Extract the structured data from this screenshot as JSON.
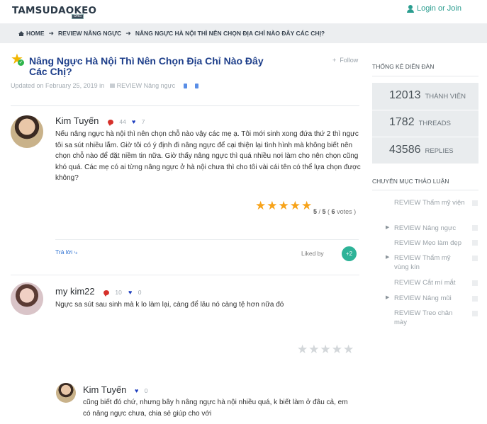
{
  "header": {
    "logo": "TAMSUDAOKEO",
    "logo_sub": "ORG",
    "login": "Login or Join"
  },
  "breadcrumbs": [
    "HOME",
    "REVIEW NÂNG NGỰC",
    "NÂNG NGỰC HÀ NỘI THÌ NÊN CHỌN ĐỊA CHỈ NÀO ĐÂY CÁC CHỊ?"
  ],
  "thread": {
    "title": "Nâng Ngực Hà Nội Thì Nên Chọn Địa Chỉ Nào Đây Các Chị?",
    "follow": "Follow",
    "meta_updated": "Updated on February 25, 2019 in",
    "meta_category": "REVIEW Nâng ngực"
  },
  "posts": [
    {
      "author": "Kim Tuyến",
      "comments": "44",
      "likes": "7",
      "text": "Nếu nâng ngực hà nội thì nên chọn chỗ nào vậy các mẹ ạ. Tôi mới sinh xong đứa thứ 2 thì ngực tôi sa sút nhiều lắm. Giờ tôi có ý định đi nâng ngực để cại thiện lại tình hình mà không biết nên chọn chỗ nào để đặt niềm tin nữa. Giờ thấy nâng ngực thì quá nhiều nơi làm cho nên chọn cũng khó quá. Các mẹ có ai từng nâng ngực ở hà nội chưa thì cho tôi vài cái tên có thể lựa chọn được không?",
      "rating_score": "5",
      "rating_max": "5",
      "votes": "6",
      "votes_label": "votes",
      "stars_filled": 5,
      "reply_label": "Trả lời",
      "liked_by": "Liked by",
      "liked_count": "+2"
    },
    {
      "author": "my kim22",
      "comments": "10",
      "likes": "0",
      "text": "Ngực sa sút sau sinh mà k lo làm lại, càng để lâu nó càng tệ hơn nữa đó",
      "stars_filled": 0
    },
    {
      "author": "Kim Tuyến",
      "likes": "0",
      "text": "cũng biết đó chứ, nhưng bây h nâng ngực hà nội nhiều quá, k biết làm ở đâu cả, em có nâng ngực chưa, chia sẻ giúp cho với"
    }
  ],
  "sidebar": {
    "stats_heading": "THỐNG KÊ DIỄN ĐÀN",
    "stats": [
      {
        "value": "12013",
        "label": "THÀNH VIÊN"
      },
      {
        "value": "1782",
        "label": "THREADS"
      },
      {
        "value": "43586",
        "label": "REPLIES"
      }
    ],
    "categories_heading": "CHUYÊN MỤC THẢO LUẬN",
    "categories": [
      {
        "label": "REVIEW Thẩm mỹ viện",
        "has_children": false
      },
      {
        "label": "REVIEW Nâng ngực",
        "has_children": true
      },
      {
        "label": "REVIEW Mẹo làm đẹp",
        "has_children": false
      },
      {
        "label": "REVIEW Thẩm mỹ vùng kín",
        "has_children": true
      },
      {
        "label": "REVIEW Cắt mí mắt",
        "has_children": false
      },
      {
        "label": "REVIEW Nâng mũi",
        "has_children": true
      },
      {
        "label": "REVIEW Treo chân mày",
        "has_children": false
      }
    ]
  },
  "icons": {
    "user": "user-icon",
    "home": "home-icon",
    "arrow": "arrow-right-icon",
    "comment": "comment-bubble-icon",
    "heart": "heart-icon",
    "star": "star-icon",
    "reply": "reply-arrow-icon"
  },
  "colors": {
    "title_blue": "#1d3e8a",
    "accent_teal": "#2a9d8f",
    "star_orange": "#f7a31a",
    "badge_green": "#2eb398"
  }
}
